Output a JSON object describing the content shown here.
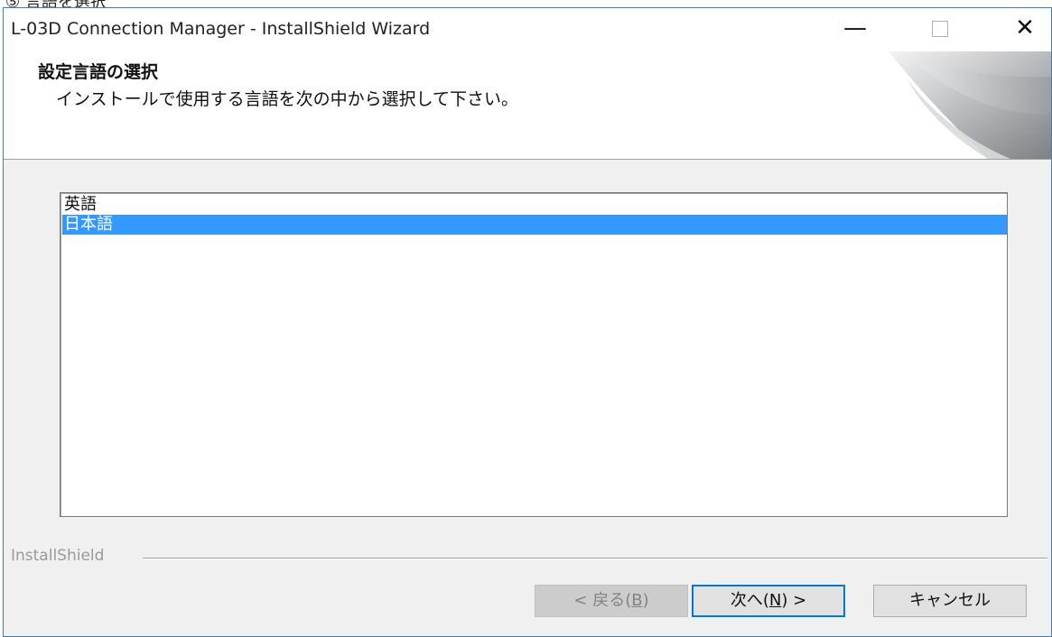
{
  "window": {
    "title": "L-03D Connection Manager - InstallShield Wizard",
    "minimize_glyph": "—",
    "close_glyph": "✕"
  },
  "header": {
    "title": "設定言語の選択",
    "subtitle": "インストールで使用する言語を次の中から選択して下さい。"
  },
  "language_list": {
    "items": [
      {
        "label": "英語",
        "selected": false
      },
      {
        "label": "日本語",
        "selected": true
      }
    ]
  },
  "footer": {
    "brand": "InstallShield"
  },
  "buttons": {
    "back": {
      "prefix": "< 戻る(",
      "key": "B",
      "suffix": ")",
      "enabled": false
    },
    "next": {
      "prefix": "次へ(",
      "key": "N",
      "suffix": ") >",
      "default": true
    },
    "cancel": {
      "label": "キャンセル"
    }
  },
  "colors": {
    "selection": "#3399ff",
    "default_button_border": "#0078d7",
    "window_border": "#3c7fb1"
  },
  "icons": [
    "minimize-icon",
    "maximize-icon",
    "close-icon",
    "installshield-logo-graphic"
  ]
}
